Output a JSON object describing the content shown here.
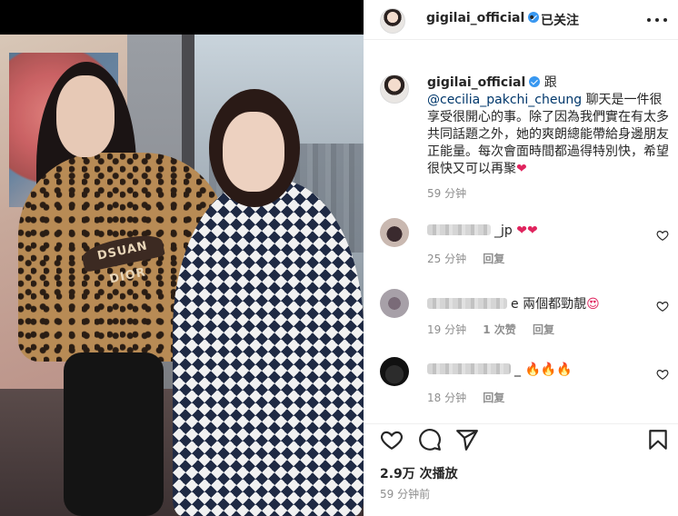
{
  "post": {
    "username": "gigilai_official",
    "follow_status": "已关注",
    "separator": "•",
    "media_text": "DSUAN DIOR"
  },
  "caption": {
    "username": "gigilai_official",
    "prefix": "跟",
    "mention": "@cecilia_pakchi_cheung",
    "body": "聊天是一件很享受很開心的事。除了因為我們實在有太多共同話題之外，她的爽朗總能帶給身邊朋友正能量。每次會面時間都過得特別快，希望很快又可以再聚",
    "emoji": "❤",
    "time": "59 分钟"
  },
  "comments": [
    {
      "name_visible": "_jp",
      "text": "",
      "emoji": "❤❤",
      "time": "25 分钟",
      "likes": "",
      "reply": "回复"
    },
    {
      "name_visible": "e",
      "text": "兩個都勁靚",
      "emoji": "😍",
      "time": "19 分钟",
      "likes": "1 次赞",
      "reply": "回复"
    },
    {
      "name_visible": "_",
      "text": "",
      "emoji": "🔥🔥🔥",
      "time": "18 分钟",
      "likes": "",
      "reply": "回复"
    }
  ],
  "stats": {
    "views": "2.9万 次播放",
    "posted": "59 分钟前"
  },
  "icons": {
    "like": "heart-icon",
    "comment": "comment-icon",
    "share": "send-icon",
    "save": "bookmark-icon",
    "more": "more-icon",
    "verified": "verified-badge-icon"
  },
  "colors": {
    "verified": "#3897f0",
    "mention": "#00376b",
    "secondary_text": "#8e8e8e",
    "heart": "#e0245e"
  }
}
